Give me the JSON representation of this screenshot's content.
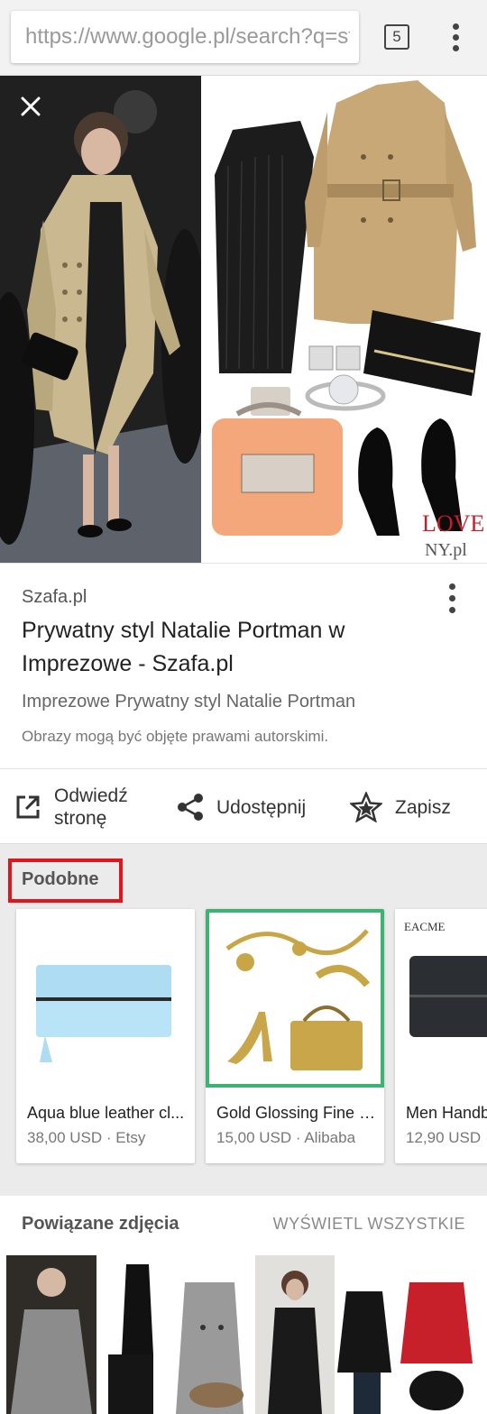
{
  "browser": {
    "url": "https://www.google.pl/search?q=st",
    "tab_count": "5"
  },
  "preview": {
    "watermark_top": "LOVE",
    "watermark_bottom": "NY.pl"
  },
  "result": {
    "source": "Szafa.pl",
    "title": "Prywatny styl Natalie Portman w Imprezowe - Szafa.pl",
    "description": "Imprezowe Prywatny styl Natalie Portman",
    "copyright": "Obrazy mogą być objęte prawami autorskimi."
  },
  "actions": {
    "visit_line1": "Odwiedź",
    "visit_line2": "stronę",
    "share": "Udostępnij",
    "save": "Zapisz"
  },
  "similar": {
    "heading": "Podobne",
    "items": [
      {
        "name": "Aqua blue leather cl...",
        "price": "38,00 USD · Etsy"
      },
      {
        "name": "Gold Glossing Fine P...",
        "price": "15,00 USD · Alibaba"
      },
      {
        "name": "Men Handb",
        "price": "12,90 USD ·",
        "brand": "EACME"
      }
    ]
  },
  "related": {
    "heading": "Powiązane zdjęcia",
    "view_all": "WYŚWIETL WSZYSTKIE"
  },
  "colors": {
    "highlight": "#e3141d",
    "selected_border": "#3cb371"
  }
}
